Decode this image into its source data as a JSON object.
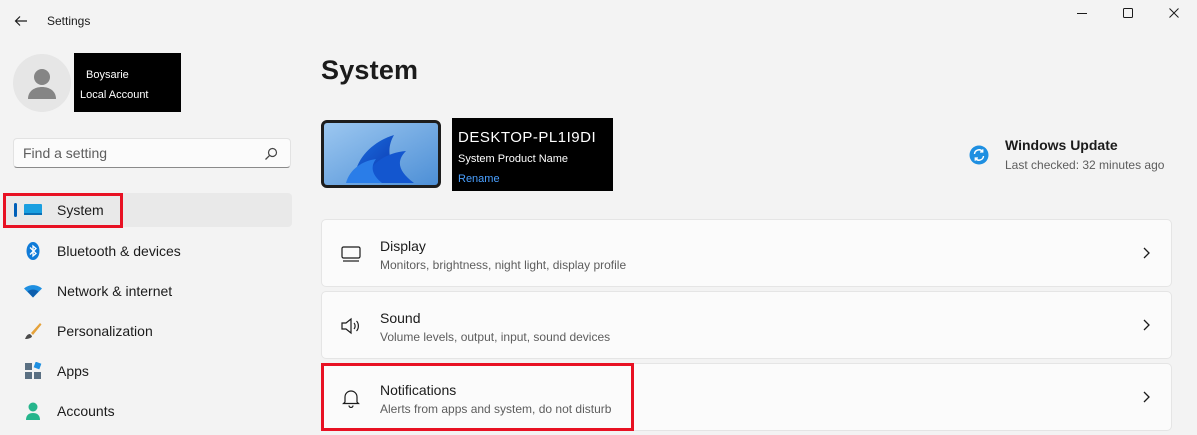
{
  "window": {
    "title": "Settings",
    "controls": {
      "minimize": "minimize-icon",
      "maximize": "maximize-icon",
      "close": "close-icon"
    }
  },
  "profile": {
    "name": "Boysarie",
    "account_type": "Local Account"
  },
  "search": {
    "placeholder": "Find a setting"
  },
  "nav": {
    "items": [
      {
        "label": "System",
        "icon": "system-display-icon",
        "active": true
      },
      {
        "label": "Bluetooth & devices",
        "icon": "bluetooth-icon"
      },
      {
        "label": "Network & internet",
        "icon": "wifi-icon"
      },
      {
        "label": "Personalization",
        "icon": "paintbrush-icon"
      },
      {
        "label": "Apps",
        "icon": "apps-icon"
      },
      {
        "label": "Accounts",
        "icon": "person-icon"
      }
    ]
  },
  "main": {
    "title": "System",
    "device": {
      "name": "DESKTOP-PL1I9DI",
      "model": "System Product Name",
      "rename": "Rename"
    },
    "windows_update": {
      "title": "Windows Update",
      "last_checked": "Last checked: 32 minutes ago"
    },
    "cards": [
      {
        "title": "Display",
        "subtitle": "Monitors, brightness, night light, display profile",
        "icon": "monitor-icon"
      },
      {
        "title": "Sound",
        "subtitle": "Volume levels, output, input, sound devices",
        "icon": "speaker-icon"
      },
      {
        "title": "Notifications",
        "subtitle": "Alerts from apps and system, do not disturb",
        "icon": "bell-icon"
      }
    ]
  },
  "colors": {
    "accent": "#005fb8",
    "highlight": "#e81123",
    "background": "#f3f3f3"
  }
}
